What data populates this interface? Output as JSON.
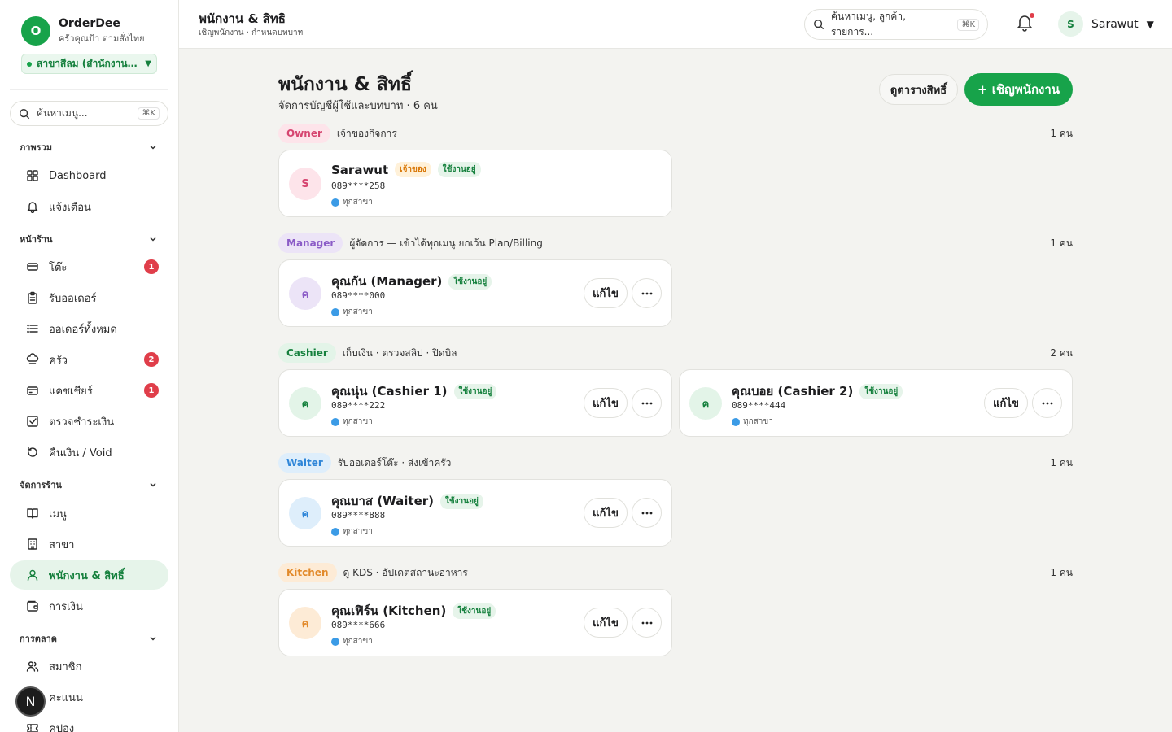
{
  "colors": {
    "accent": "#17a34a",
    "badge": "#e03e4a",
    "background": "#f3f3f0"
  },
  "brand": {
    "logo_letter": "O",
    "name": "OrderDee",
    "tagline": "ครัวคุณป้า ตามสั่งไทย"
  },
  "branch": {
    "label": "สาขาสีลม (สำนักงานให..."
  },
  "sidebar_search": {
    "placeholder": "ค้นหาเมนู...",
    "shortcut": "⌘K"
  },
  "sidebar": {
    "sections": [
      {
        "label": "ภาพรวม",
        "items": [
          {
            "label": "Dashboard",
            "icon": "grid-icon"
          },
          {
            "label": "แจ้งเตือน",
            "icon": "bell-icon"
          }
        ]
      },
      {
        "label": "หน้าร้าน",
        "items": [
          {
            "label": "โต๊ะ",
            "icon": "table-icon",
            "badge": "1"
          },
          {
            "label": "รับออเดอร์",
            "icon": "clipboard-icon"
          },
          {
            "label": "ออเดอร์ทั้งหมด",
            "icon": "list-icon"
          },
          {
            "label": "ครัว",
            "icon": "chef-hat-icon",
            "badge": "2"
          },
          {
            "label": "แคชเชียร์",
            "icon": "card-icon",
            "badge": "1"
          },
          {
            "label": "ตรวจชำระเงิน",
            "icon": "check-square-icon"
          },
          {
            "label": "คืนเงิน / Void",
            "icon": "undo-icon"
          }
        ]
      },
      {
        "label": "จัดการร้าน",
        "items": [
          {
            "label": "เมนู",
            "icon": "book-icon"
          },
          {
            "label": "สาขา",
            "icon": "building-icon"
          },
          {
            "label": "พนักงาน & สิทธิ์",
            "icon": "user-icon",
            "active": true
          },
          {
            "label": "การเงิน",
            "icon": "wallet-icon"
          }
        ]
      },
      {
        "label": "การตลาด",
        "items": [
          {
            "label": "สมาชิก",
            "icon": "users-icon"
          },
          {
            "label": "คะแนน",
            "icon": "star-icon"
          },
          {
            "label": "คูปอง",
            "icon": "ticket-icon"
          }
        ]
      }
    ]
  },
  "fab": {
    "label": "N"
  },
  "topbar": {
    "title": "พนักงาน & สิทธิ",
    "subtitle": "เชิญพนักงาน · กำหนดบทบาท",
    "search_placeholder": "ค้นหาเมนู, ลูกค้า, รายการ...",
    "search_shortcut": "⌘K",
    "user_initial": "S",
    "user_name": "Sarawut",
    "user_caret": "▼"
  },
  "page": {
    "title": "พนักงาน & สิทธิ์",
    "subtitle": "จัดการบัญชีผู้ใช้และบทบาท · 6 คน",
    "view_permissions_label": "ดูตารางสิทธิ์",
    "invite_label": "+ เชิญพนักงาน"
  },
  "groups": [
    {
      "role": "Owner",
      "description": "เจ้าของกิจการ",
      "count": "1 คน",
      "pill_bg": "#fde4ea",
      "pill_fg": "#d64570",
      "members": [
        {
          "initial": "S",
          "name": "Sarawut",
          "owner_tag": "เจ้าของ",
          "status": "ใช้งานอยู่",
          "phone": "089****258",
          "scope": "ทุกสาขา",
          "avatar_bg": "#fde4ea",
          "avatar_fg": "#d64570"
        }
      ]
    },
    {
      "role": "Manager",
      "description": "ผู้จัดการ — เข้าได้ทุกเมนู ยกเว้น Plan/Billing",
      "count": "1 คน",
      "pill_bg": "#ece4f7",
      "pill_fg": "#8b5cc7",
      "members": [
        {
          "initial": "ค",
          "name": "คุณกัน (Manager)",
          "status": "ใช้งานอยู่",
          "phone": "089****000",
          "scope": "ทุกสาขา",
          "edit": "แก้ไข",
          "avatar_bg": "#ece4f7",
          "avatar_fg": "#8b5cc7"
        }
      ]
    },
    {
      "role": "Cashier",
      "description": "เก็บเงิน · ตรวจสลิป · ปิดบิล",
      "count": "2 คน",
      "pill_bg": "#e3f4e8",
      "pill_fg": "#15803d",
      "members": [
        {
          "initial": "ค",
          "name": "คุณนุ่น (Cashier 1)",
          "status": "ใช้งานอยู่",
          "phone": "089****222",
          "scope": "ทุกสาขา",
          "edit": "แก้ไข",
          "avatar_bg": "#e3f4e8",
          "avatar_fg": "#15803d"
        },
        {
          "initial": "ค",
          "name": "คุณบอย (Cashier 2)",
          "status": "ใช้งานอยู่",
          "phone": "089****444",
          "scope": "ทุกสาขา",
          "edit": "แก้ไข",
          "avatar_bg": "#e3f4e8",
          "avatar_fg": "#15803d"
        }
      ]
    },
    {
      "role": "Waiter",
      "description": "รับออเดอร์โต๊ะ · ส่งเข้าครัว",
      "count": "1 คน",
      "pill_bg": "#deeefb",
      "pill_fg": "#2f86d8",
      "members": [
        {
          "initial": "ค",
          "name": "คุณบาส (Waiter)",
          "status": "ใช้งานอยู่",
          "phone": "089****888",
          "scope": "ทุกสาขา",
          "edit": "แก้ไข",
          "avatar_bg": "#deeefb",
          "avatar_fg": "#2f86d8"
        }
      ]
    },
    {
      "role": "Kitchen",
      "description": "ดู KDS · อัปเดตสถานะอาหาร",
      "count": "1 คน",
      "pill_bg": "#fdebd6",
      "pill_fg": "#e28a2b",
      "members": [
        {
          "initial": "ค",
          "name": "คุณเฟิร์น (Kitchen)",
          "status": "ใช้งานอยู่",
          "phone": "089****666",
          "scope": "ทุกสาขา",
          "edit": "แก้ไข",
          "avatar_bg": "#fdebd6",
          "avatar_fg": "#e28a2b"
        }
      ]
    }
  ]
}
